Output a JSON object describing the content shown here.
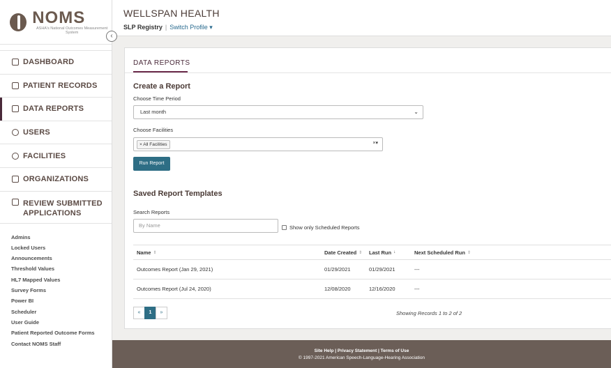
{
  "logo": {
    "title": "NOMS",
    "subtitle": "ASHA's National Outcomes Measurement System"
  },
  "header": {
    "org_name": "WELLSPAN HEALTH",
    "registry": "SLP Registry",
    "switch_profile": "Switch Profile"
  },
  "nav": [
    {
      "label": "DASHBOARD",
      "icon": "grid-icon"
    },
    {
      "label": "PATIENT RECORDS",
      "icon": "id-card-icon"
    },
    {
      "label": "DATA REPORTS",
      "icon": "bar-chart-icon"
    },
    {
      "label": "USERS",
      "icon": "users-icon"
    },
    {
      "label": "FACILITIES",
      "icon": "map-pin-icon"
    },
    {
      "label": "ORGANIZATIONS",
      "icon": "building-icon"
    },
    {
      "label": "REVIEW SUBMITTED APPLICATIONS",
      "icon": "list-icon"
    }
  ],
  "links": [
    "Admins",
    "Locked Users",
    "Announcements",
    "Threshold Values",
    "HL7 Mapped Values",
    "Survey Forms",
    "Power BI",
    "Scheduler",
    "User Guide",
    "Patient Reported Outcome Forms",
    "Contact NOMS Staff"
  ],
  "page": {
    "title": "DATA REPORTS",
    "create_heading": "Create a Report",
    "time_period_label": "Choose Time Period",
    "time_period_value": "Last month",
    "facilities_label": "Choose Facilities",
    "facility_chip": "All Facilities",
    "run_button": "Run Report",
    "saved_heading": "Saved Report Templates",
    "search_label": "Search Reports",
    "search_placeholder": "By Name",
    "scheduled_only_label": "Show only Scheduled Reports"
  },
  "table": {
    "columns": [
      "Name",
      "Date Created",
      "Last Run",
      "Next Scheduled Run"
    ],
    "rows": [
      [
        "Outcomes Report (Jan 29, 2021)",
        "01/29/2021",
        "01/29/2021",
        "---"
      ],
      [
        "Outcomes Report (Jul 24, 2020)",
        "12/08/2020",
        "12/16/2020",
        "---"
      ]
    ]
  },
  "pagination": {
    "prev": "«",
    "current": "1",
    "next": "»",
    "showing": "Showing Records 1 to 2 of 2"
  },
  "footer": {
    "links": "Site Help | Privacy Statement | Terms of Use",
    "copyright": "© 1997-2021 American Speech-Language-Hearing Association"
  }
}
